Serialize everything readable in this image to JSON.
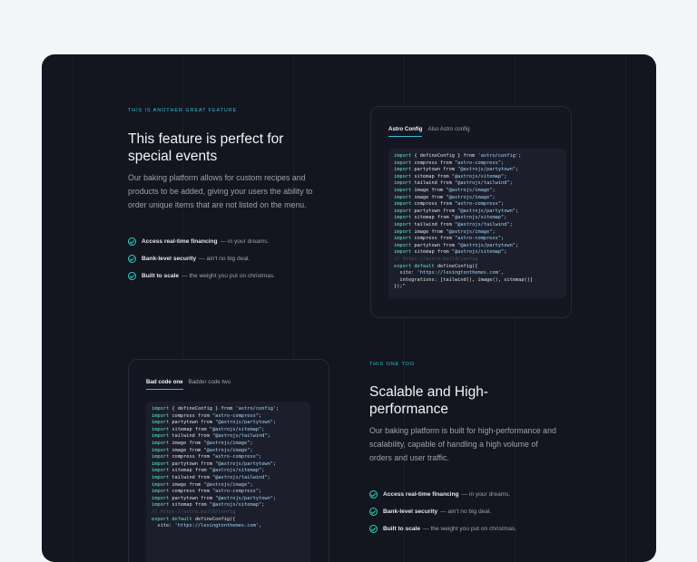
{
  "feature1": {
    "eyebrow": "THIS IS ANOTHER GREAT FEATURE",
    "title_line1": "This feature is perfect for",
    "title_line2": "special events",
    "body_lines": [
      "Our baking platform allows for custom recipes and",
      "products to be added, giving your users the ability to",
      "order unique items that are not listed on the menu."
    ],
    "bullets": [
      {
        "bold": "Access real-time financing",
        "rest": "— in your dreams."
      },
      {
        "bold": "Bank-level security",
        "rest": "— ain't no big deal."
      },
      {
        "bold": "Built to scale",
        "rest": "— the weight you put on christmas."
      }
    ]
  },
  "card1": {
    "tabs": [
      "Astro Config",
      "Also Astro config"
    ],
    "code": [
      "import { defineConfig } from 'astro/config';",
      "import compress from \"astro-compress\";",
      "import partytown from \"@astrojs/partytown\";",
      "import sitemap from \"@astrojs/sitemap\";",
      "import tailwind from \"@astrojs/tailwind\";",
      "import image from \"@astrojs/image\";",
      "import image from \"@astrojs/image\";",
      "import compress from \"astro-compress\";",
      "import partytown from \"@astrojs/partytown\";",
      "import sitemap from \"@astrojs/sitemap\";",
      "import tailwind from \"@astrojs/tailwind\";",
      "import image from \"@astrojs/image\";",
      "import compress from \"astro-compress\";",
      "import partytown from \"@astrojs/partytown\";",
      "import sitemap from \"@astrojs/sitemap\";",
      "// https://astro.build/config",
      "export default defineConfig({",
      "  site: 'https://lexingtonthemes.com',",
      "  integrations: [tailwind(), image(), sitemap()]",
      "});\""
    ]
  },
  "feature2": {
    "eyebrow": "THIS ONE TOO",
    "title_line1": "Scalable and High-",
    "title_line2": "performance",
    "body_lines": [
      "Our baking platform is built for high-performance and",
      "scalability, capable of handling a high volume of",
      "orders and user traffic."
    ],
    "bullets": [
      {
        "bold": "Access real-time financing",
        "rest": "— in your dreams."
      },
      {
        "bold": "Bank-level security",
        "rest": "— ain't no big deal."
      },
      {
        "bold": "Built to scale",
        "rest": "— the weight you put on christmas."
      }
    ]
  },
  "card2": {
    "tabs": [
      "Bad code one",
      "Badder code two"
    ],
    "code": [
      "import { defineConfig } from 'astro/config';",
      "import compress from \"astro-compress\";",
      "import partytown from \"@astrojs/partytown\";",
      "import sitemap from \"@astrojs/sitemap\";",
      "import tailwind from \"@astrojs/tailwind\";",
      "import image from \"@astrojs/image\";",
      "import image from \"@astrojs/image\";",
      "import compress from \"astro-compress\";",
      "import partytown from \"@astrojs/partytown\";",
      "import sitemap from \"@astrojs/sitemap\";",
      "import tailwind from \"@astrojs/tailwind\";",
      "import image from \"@astrojs/image\";",
      "import compress from \"astro-compress\";",
      "import partytown from \"@astrojs/partytown\";",
      "import sitemap from \"@astrojs/sitemap\";",
      "// https://astro.build/config",
      "export default defineConfig({",
      "  site: 'https://lexingtonthemes.com',"
    ]
  },
  "colors": {
    "background": "#f4f5f8",
    "panel": "#13151f",
    "accent": "#38bdd8",
    "check": "#2dd4bf"
  },
  "icons": {
    "bullet": "check-circle-icon"
  }
}
